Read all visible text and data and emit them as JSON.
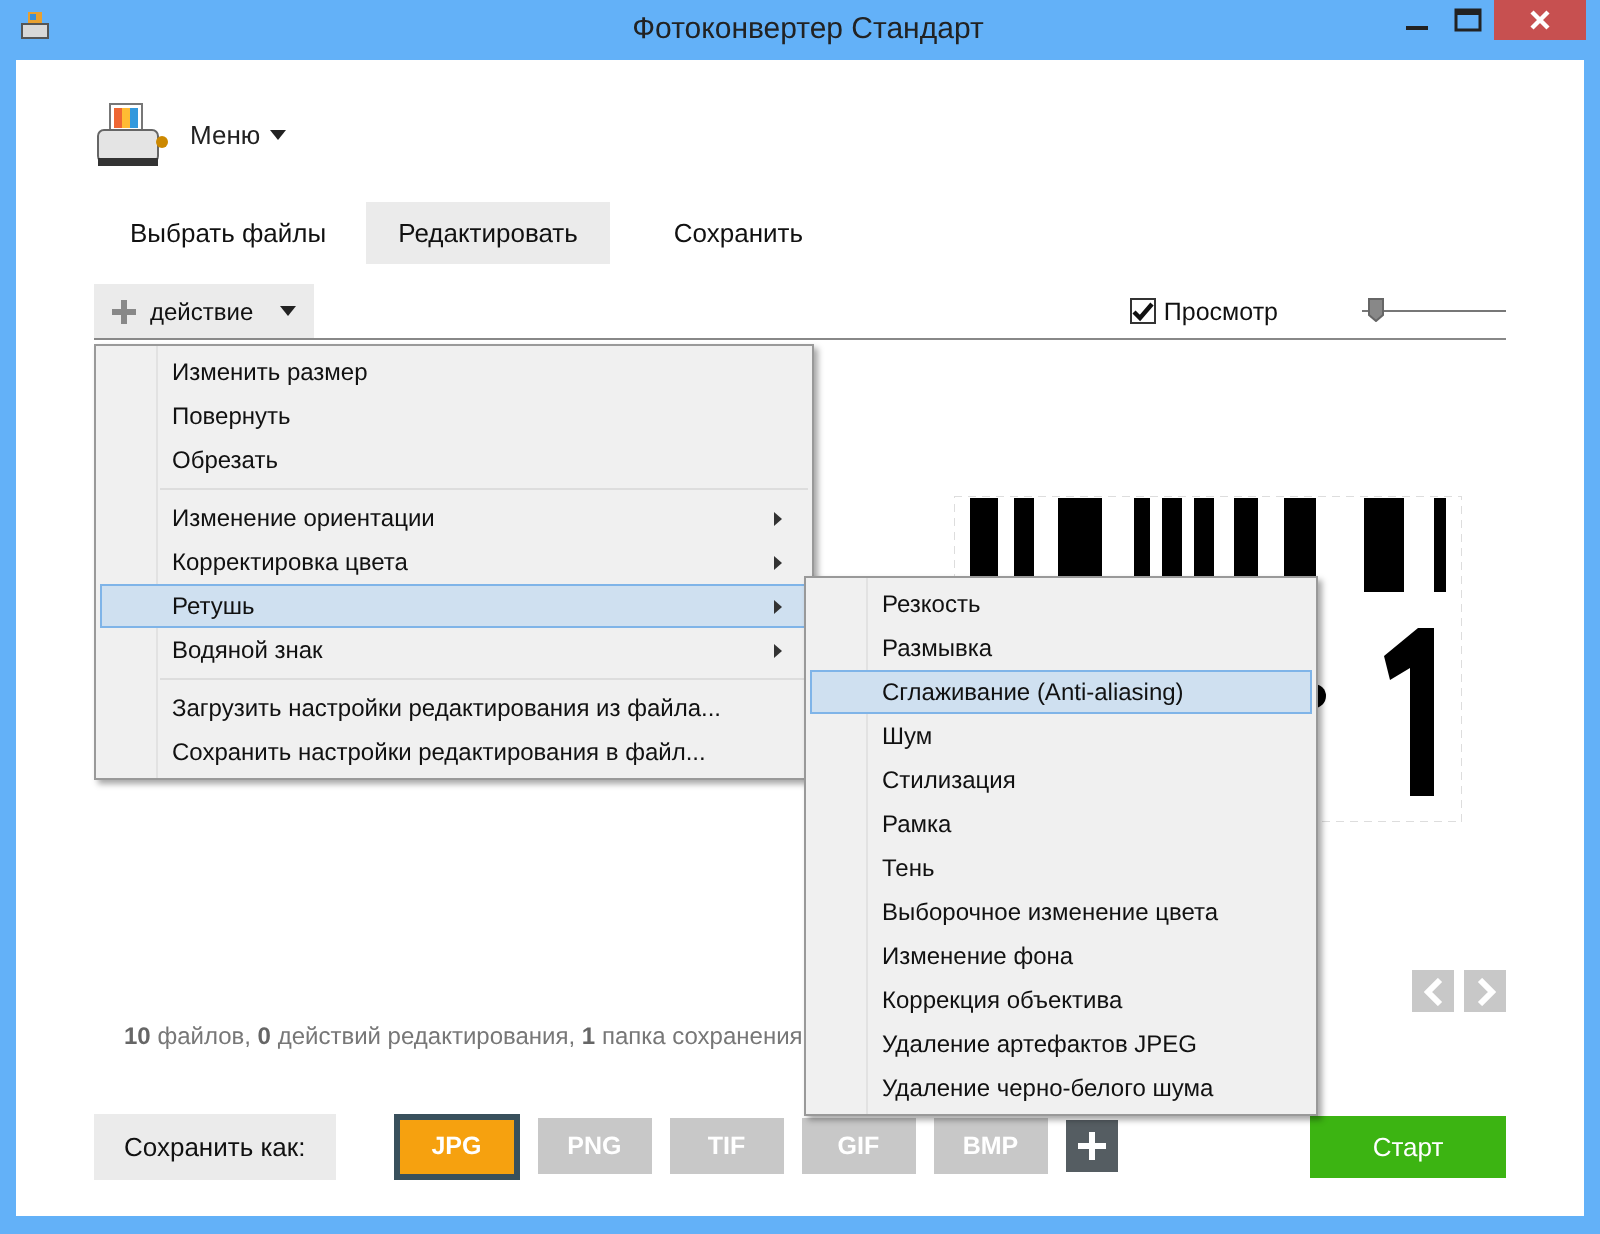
{
  "window": {
    "title": "Фотоконвертер Стандарт"
  },
  "app_menu": {
    "label": "Меню"
  },
  "tabs": [
    {
      "label": "Выбрать файлы",
      "selected": false
    },
    {
      "label": "Редактировать",
      "selected": true
    },
    {
      "label": "Сохранить",
      "selected": false
    }
  ],
  "action_button": {
    "label": "действие"
  },
  "preview": {
    "label": "Просмотр",
    "checked": true
  },
  "zoom_slider": {
    "level": 0.05
  },
  "action_menu": {
    "groups": [
      [
        {
          "label": "Изменить размер",
          "submenu": false,
          "selected": false
        },
        {
          "label": "Повернуть",
          "submenu": false,
          "selected": false
        },
        {
          "label": "Обрезать",
          "submenu": false,
          "selected": false
        }
      ],
      [
        {
          "label": "Изменение ориентации",
          "submenu": true,
          "selected": false
        },
        {
          "label": "Корректировка цвета",
          "submenu": true,
          "selected": false
        },
        {
          "label": "Ретушь",
          "submenu": true,
          "selected": true
        },
        {
          "label": "Водяной знак",
          "submenu": true,
          "selected": false
        }
      ],
      [
        {
          "label": "Загрузить настройки редактирования из файла...",
          "submenu": false,
          "selected": false
        },
        {
          "label": "Сохранить настройки редактирования в файл...",
          "submenu": false,
          "selected": false
        }
      ]
    ]
  },
  "retouch_submenu": [
    {
      "label": "Резкость",
      "selected": false
    },
    {
      "label": "Размывка",
      "selected": false
    },
    {
      "label": "Сглаживание (Anti-aliasing)",
      "selected": true
    },
    {
      "label": "Шум",
      "selected": false
    },
    {
      "label": "Стилизация",
      "selected": false
    },
    {
      "label": "Рамка",
      "selected": false
    },
    {
      "label": "Тень",
      "selected": false
    },
    {
      "label": "Выборочное изменение цвета",
      "selected": false
    },
    {
      "label": "Изменение фона",
      "selected": false
    },
    {
      "label": "Коррекция объектива",
      "selected": false
    },
    {
      "label": "Удаление артефактов JPEG",
      "selected": false
    },
    {
      "label": "Удаление черно-белого шума",
      "selected": false
    }
  ],
  "status": "**10** файлов, **0** действий редактирования, **1** папка сохранения",
  "save_as": {
    "label": "Сохранить как:"
  },
  "formats": [
    {
      "label": "JPG",
      "selected": true
    },
    {
      "label": "PNG",
      "selected": false
    },
    {
      "label": "TIF",
      "selected": false
    },
    {
      "label": "GIF",
      "selected": false
    },
    {
      "label": "BMP",
      "selected": false
    }
  ],
  "start_button": {
    "label": "Старт"
  }
}
